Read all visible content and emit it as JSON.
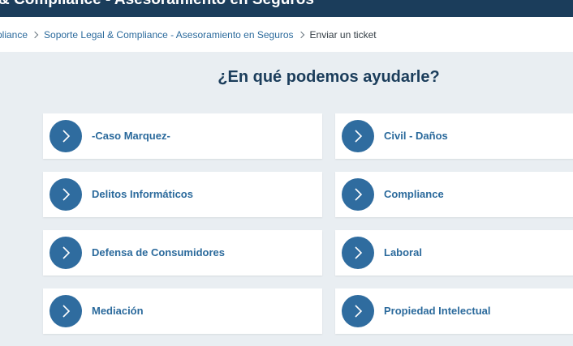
{
  "header": {
    "title": "& Compliance - Asesoramiento en Seguros"
  },
  "breadcrumb": {
    "items": [
      {
        "label": "pliance",
        "link": true
      },
      {
        "label": "Soporte Legal & Compliance - Asesoramiento en Seguros",
        "link": true
      },
      {
        "label": "Enviar un ticket",
        "link": false
      }
    ]
  },
  "main": {
    "heading": "¿En qué podemos ayudarle?",
    "categories": [
      {
        "label": "-Caso Marquez-",
        "icon": "chevron-right-icon"
      },
      {
        "label": "Civil - Daños",
        "icon": "chevron-right-icon"
      },
      {
        "label": "Delitos Informáticos",
        "icon": "chevron-right-icon"
      },
      {
        "label": "Compliance",
        "icon": "chevron-right-icon"
      },
      {
        "label": "Defensa de Consumidores",
        "icon": "chevron-right-icon"
      },
      {
        "label": "Laboral",
        "icon": "chevron-right-icon"
      },
      {
        "label": "Mediación",
        "icon": "chevron-right-icon"
      },
      {
        "label": "Propiedad Intelectual",
        "icon": "chevron-right-icon"
      }
    ]
  },
  "colors": {
    "header_bg": "#1b3d5b",
    "page_bg": "#e9eef2",
    "accent": "#2f6c9f",
    "link": "#2b6a9c"
  }
}
